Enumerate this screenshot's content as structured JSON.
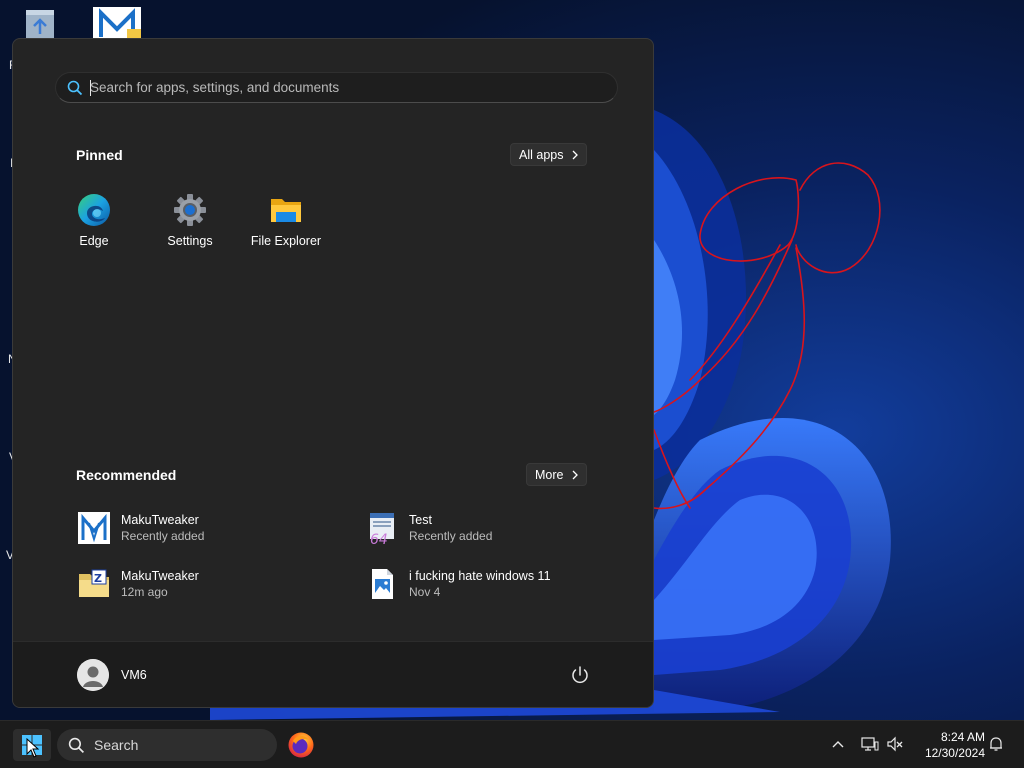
{
  "desktop": {
    "edge_letters": [
      "F",
      "I",
      "N",
      "V",
      "V"
    ]
  },
  "start_menu": {
    "search": {
      "placeholder": "Search for apps, settings, and documents",
      "value": ""
    },
    "pinned": {
      "title": "Pinned",
      "all_apps_label": "All apps",
      "apps": [
        {
          "label": "Edge",
          "icon": "edge-icon"
        },
        {
          "label": "Settings",
          "icon": "settings-gear-icon"
        },
        {
          "label": "File Explorer",
          "icon": "folder-icon"
        }
      ]
    },
    "recommended": {
      "title": "Recommended",
      "more_label": "More",
      "items": [
        {
          "name": "MakuTweaker",
          "detail": "Recently added",
          "icon": "makutweaker-icon"
        },
        {
          "name": "Test",
          "detail": "Recently added",
          "icon": "test-app-icon"
        },
        {
          "name": "MakuTweaker",
          "detail": "12m ago",
          "icon": "zip-folder-icon"
        },
        {
          "name": "i fucking hate windows 11",
          "detail": "Nov 4",
          "icon": "image-file-icon"
        }
      ]
    },
    "user": {
      "name": "VM6"
    }
  },
  "taskbar": {
    "search_label": "Search",
    "clock": {
      "time": "8:24 AM",
      "date": "12/30/2024"
    }
  },
  "colors": {
    "accent": "#4cc2ff",
    "menu_bg": "#242424",
    "scribble": "#d8141c"
  }
}
